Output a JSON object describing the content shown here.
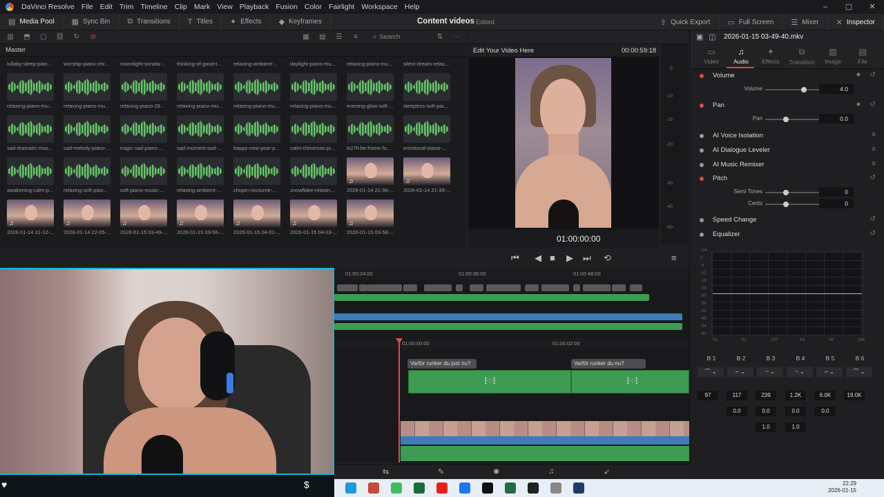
{
  "app": {
    "menu": [
      "DaVinci Resolve",
      "File",
      "Edit",
      "Trim",
      "Timeline",
      "Clip",
      "Mark",
      "View",
      "Playback",
      "Fusion",
      "Color",
      "Fairlight",
      "Workspace",
      "Help"
    ],
    "window_controls": [
      "–",
      "▢",
      "✕"
    ]
  },
  "toolbar": {
    "left": [
      "Media Pool",
      "Sync Bin",
      "Transitions",
      "Titles",
      "Effects",
      "Keyframes"
    ],
    "project_title": "Content videos",
    "project_state": "Edited",
    "right": [
      "Quick Export",
      "Full Screen",
      "Mixer",
      "Inspector"
    ]
  },
  "media_pool": {
    "search_placeholder": "Search",
    "bin": "Master",
    "top_labels": [
      "lullaby-sleep-pian...",
      "worship-piano-chr...",
      "moonlight-sonata-...",
      "thinking-of-good-t...",
      "relaxing-ambient-...",
      "daylight-piano-mu...",
      "relaxing-piano-mu...",
      "silent-dream-relax..."
    ],
    "clips": [
      {
        "label": "relaxing-piano-mu...",
        "kind": "audio"
      },
      {
        "label": "relaxing-piano-mu...",
        "kind": "audio"
      },
      {
        "label": "relaxing-piano-29...",
        "kind": "audio"
      },
      {
        "label": "relaxing-piano-mu...",
        "kind": "audio"
      },
      {
        "label": "relaxing-piano-mu...",
        "kind": "audio"
      },
      {
        "label": "relaxing-piano-mu...",
        "kind": "audio"
      },
      {
        "label": "evening-glow-soft-...",
        "kind": "audio"
      },
      {
        "label": "sleepless-soft-pia...",
        "kind": "audio"
      },
      {
        "label": "sad-dramatic-mus...",
        "kind": "audio"
      },
      {
        "label": "sad-melody-piano-...",
        "kind": "audio"
      },
      {
        "label": "tragic-sad-piano-...",
        "kind": "audio"
      },
      {
        "label": "sad-moment-sad-...",
        "kind": "audio"
      },
      {
        "label": "happy-new-year-p...",
        "kind": "audio"
      },
      {
        "label": "calm-christmas-pi...",
        "kind": "audio"
      },
      {
        "label": "lx27ll-be-home-fo...",
        "kind": "audio"
      },
      {
        "label": "emotional-piano-...",
        "kind": "audio"
      },
      {
        "label": "awakening-calm-p...",
        "kind": "audio"
      },
      {
        "label": "relaxing-soft-pian...",
        "kind": "audio"
      },
      {
        "label": "soft-piano-music-...",
        "kind": "audio"
      },
      {
        "label": "relaxing-ambient-...",
        "kind": "audio"
      },
      {
        "label": "chopin-nocturne-...",
        "kind": "audio"
      },
      {
        "label": "snowflake-relaxin...",
        "kind": "audio"
      },
      {
        "label": "2026-01-14 21-36-...",
        "kind": "video"
      },
      {
        "label": "2026-01-14 21-39-...",
        "kind": "video"
      },
      {
        "label": "2026-01-14 21-12-...",
        "kind": "video"
      },
      {
        "label": "2026-01-14 22-05-...",
        "kind": "video"
      },
      {
        "label": "2026-01-15 03-49-...",
        "kind": "video"
      },
      {
        "label": "2026-01-15 03-56-...",
        "kind": "video"
      },
      {
        "label": "2026-01-15 04-01-...",
        "kind": "video"
      },
      {
        "label": "2026-01-15 04-03-...",
        "kind": "video"
      },
      {
        "label": "2026-01-15 03-58-...",
        "kind": "video"
      }
    ]
  },
  "viewer": {
    "title": "Edit Your Video Here",
    "duration": "00:00:59:18",
    "timecode": "01:00:00:00",
    "meter_ticks": [
      "-5",
      "-10",
      "-15",
      "-20",
      "-30",
      "-40",
      "-50"
    ]
  },
  "timeline": {
    "overview_ticks": [
      "01:00:24:00",
      "01:00:36:00",
      "01:00:48:00"
    ],
    "ruler_ticks": [
      "01:00:00:00",
      "01:00:02:00"
    ],
    "title_clips": [
      "Varför runker du just nu?",
      "Varför runker du nu?"
    ]
  },
  "inspector": {
    "file": "2026-01-15 03-49-40.mkv",
    "tabs": [
      "Video",
      "Audio",
      "Effects",
      "Transition",
      "Image",
      "File"
    ],
    "active_tab": "Audio",
    "volume": {
      "label": "Volume",
      "param": "Volume",
      "value": "4.0"
    },
    "pan": {
      "label": "Pan",
      "param": "Pan",
      "value": "0.0"
    },
    "ai_voice": "AI Voice Isolation",
    "ai_dialogue": "AI Dialogue Leveler",
    "ai_music": "AI Music Remixer",
    "pitch": {
      "label": "Pitch",
      "semi_label": "Semi Tones",
      "semi": "0",
      "cents_label": "Cents",
      "cents": "0"
    },
    "speed_change": "Speed Change",
    "equalizer": {
      "label": "Equalizer",
      "y_ticks": [
        "+24",
        "0",
        "-6",
        "-12",
        "-18",
        "-24",
        "-30",
        "-36",
        "-42",
        "-48",
        "-54",
        "-60"
      ],
      "x_ticks": [
        "Hz",
        "62",
        "250",
        "1K",
        "4K",
        "16K"
      ],
      "bands": [
        "B 1",
        "B 2",
        "B 3",
        "B 4",
        "B 5",
        "B 6"
      ],
      "freq": [
        "97",
        "117",
        "239",
        "1.2K",
        "6.0K",
        "19.0K"
      ],
      "gain": [
        "0.0",
        "0.0",
        "0.0",
        "0.0"
      ],
      "q": [
        "1.0",
        "1.0"
      ]
    }
  },
  "taskbar": {
    "time": "22:29",
    "date": "2026-01-15"
  },
  "colors": {
    "accent_red": "#e64747",
    "clip_green": "#3d9c52",
    "audio_blue": "#3e7cb9",
    "cam_border": "#11b9d6"
  }
}
